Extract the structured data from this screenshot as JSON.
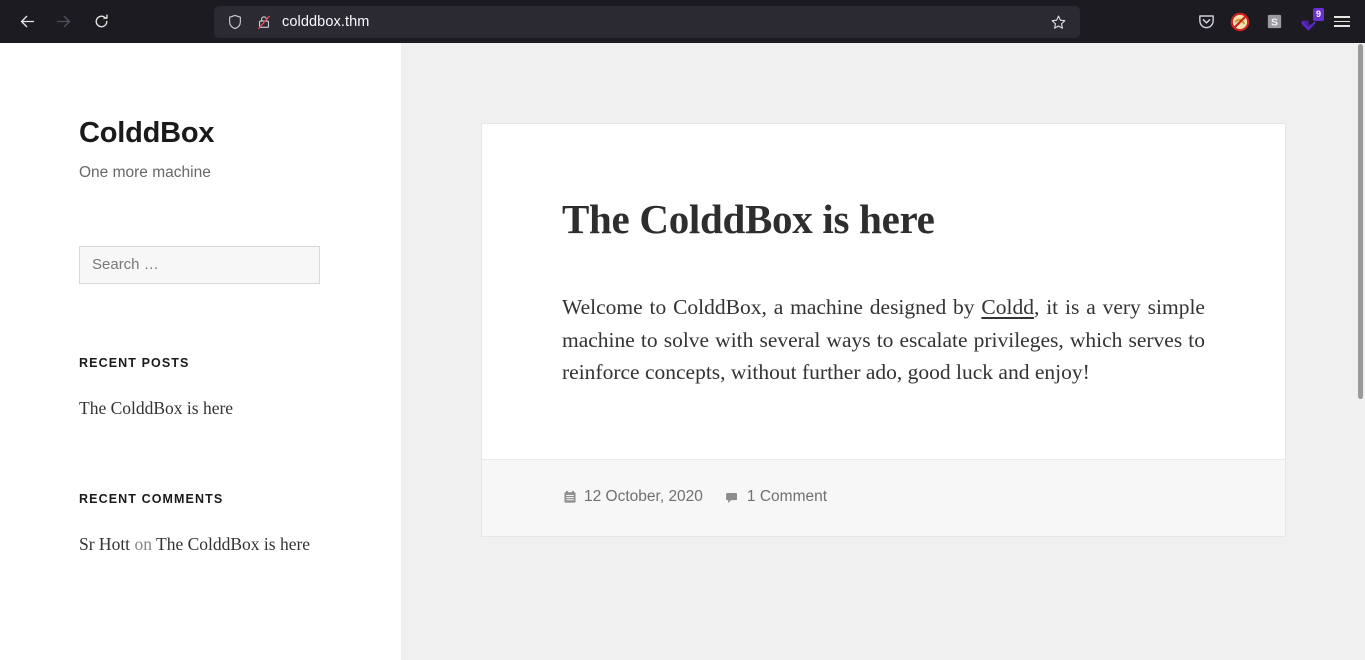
{
  "browser": {
    "back_label": "Back",
    "forward_label": "Forward",
    "reload_label": "Reload",
    "url": "colddbox.thm",
    "shield_tooltip": "Tracking Protection",
    "lock_tooltip": "Connection is not secure",
    "bookmark_tooltip": "Bookmark this page",
    "icons": {
      "back": "arrow-left-icon",
      "forward": "arrow-right-icon",
      "reload": "reload-icon",
      "shield": "shield-icon",
      "lock_broken": "broken-padlock-icon",
      "star": "star-icon",
      "pocket": "pocket-icon",
      "noscript": "noscript-icon",
      "extension_s": "s-extension-icon",
      "downloads": "downloads-arrow-icon",
      "menu": "hamburger-menu-icon"
    },
    "extension_badge_count": "9",
    "badge_color": "#6b2fd0",
    "chrome_bg": "#1c1b22",
    "urlbar_bg": "#2b2a33"
  },
  "sidebar": {
    "site_title": "ColddBox",
    "site_description": "One more machine",
    "search": {
      "placeholder": "Search …",
      "value": ""
    },
    "widgets": [
      {
        "title": "Recent Posts",
        "items": [
          {
            "text": "The ColddBox is here"
          }
        ]
      },
      {
        "title": "Recent Comments",
        "items": [
          {
            "author": "Sr Hott",
            "separator": "on",
            "post": "The ColddBox is here"
          }
        ]
      }
    ]
  },
  "article": {
    "title": "The ColddBox is here",
    "body_before_link": "Welcome to ColddBox, a machine designed by ",
    "link_text": "Coldd",
    "body_after_link": ", it is a very simple machine to solve with several ways to escalate privileges, which serves to reinforce concepts, without further ado, good luck and enjoy!",
    "meta": {
      "date": "12 October, 2020",
      "date_icon": "calendar-icon",
      "comments": "1 Comment",
      "comments_icon": "comment-bubble-icon"
    }
  },
  "colors": {
    "page_bg": "#f0f0f0",
    "card_bg": "#ffffff",
    "footer_bg": "#f7f7f7",
    "text": "#333333",
    "muted": "#707070"
  }
}
